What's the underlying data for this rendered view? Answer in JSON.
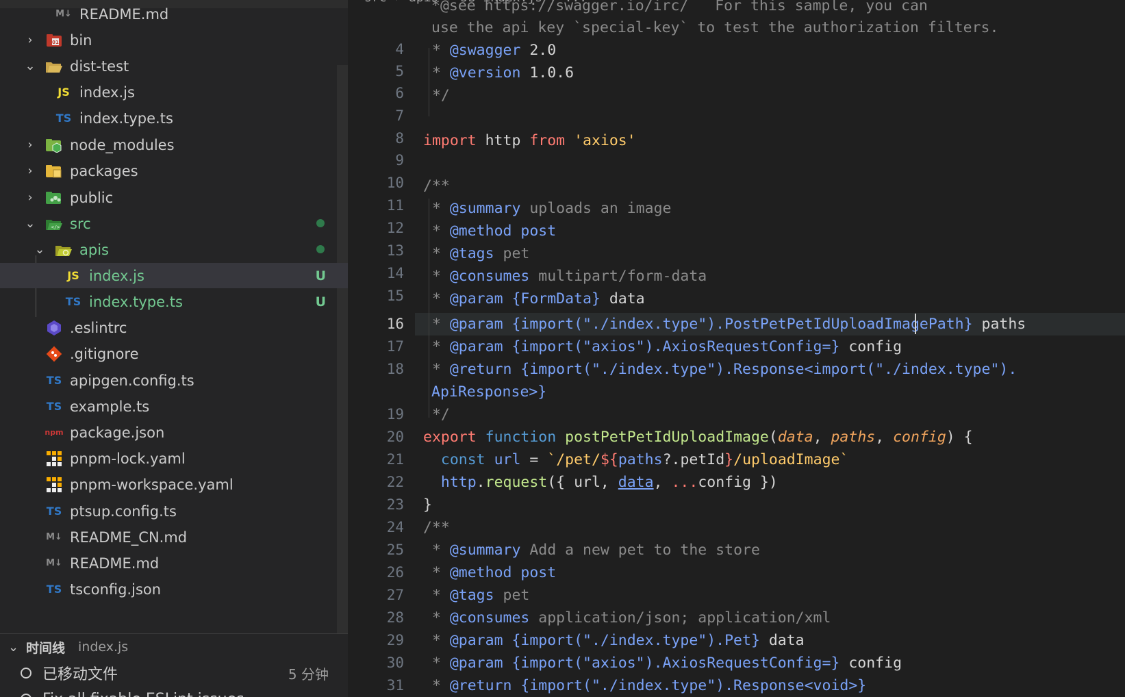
{
  "explorer": {
    "rows": [
      {
        "label": "README.md",
        "icon": "markdown-icon",
        "icon_text": "M↓",
        "kind": "file"
      },
      {
        "label": "bin",
        "icon": "folder-bin-icon",
        "kind": "folder",
        "expanded": false
      },
      {
        "label": "dist-test",
        "icon": "folder-open-icon",
        "kind": "folder",
        "expanded": true
      },
      {
        "label": "index.js",
        "icon": "js-file-icon",
        "icon_text": "JS",
        "kind": "file"
      },
      {
        "label": "index.type.ts",
        "icon": "ts-file-icon",
        "icon_text": "TS",
        "kind": "file"
      },
      {
        "label": "node_modules",
        "icon": "folder-node-icon",
        "kind": "folder",
        "expanded": false
      },
      {
        "label": "packages",
        "icon": "folder-packages-icon",
        "kind": "folder",
        "expanded": false
      },
      {
        "label": "public",
        "icon": "folder-public-icon",
        "kind": "folder",
        "expanded": false
      },
      {
        "label": "src",
        "icon": "folder-src-icon",
        "kind": "folder",
        "expanded": true
      },
      {
        "label": "apis",
        "icon": "folder-apis-icon",
        "kind": "folder",
        "expanded": true
      },
      {
        "label": "index.js",
        "icon": "js-file-icon",
        "icon_text": "JS",
        "kind": "file",
        "status": "U"
      },
      {
        "label": "index.type.ts",
        "icon": "ts-file-icon",
        "icon_text": "TS",
        "kind": "file",
        "status": "U"
      },
      {
        "label": ".eslintrc",
        "icon": "eslint-icon",
        "kind": "file"
      },
      {
        "label": ".gitignore",
        "icon": "git-icon",
        "kind": "file"
      },
      {
        "label": "apipgen.config.ts",
        "icon": "ts-file-icon",
        "icon_text": "TS",
        "kind": "file"
      },
      {
        "label": "example.ts",
        "icon": "ts-file-icon",
        "icon_text": "TS",
        "kind": "file"
      },
      {
        "label": "package.json",
        "icon": "npm-icon",
        "icon_text": "npm",
        "kind": "file"
      },
      {
        "label": "pnpm-lock.yaml",
        "icon": "pnpm-icon",
        "kind": "file"
      },
      {
        "label": "pnpm-workspace.yaml",
        "icon": "pnpm-icon",
        "kind": "file"
      },
      {
        "label": "ptsup.config.ts",
        "icon": "ts-file-icon",
        "icon_text": "TS",
        "kind": "file"
      },
      {
        "label": "README_CN.md",
        "icon": "markdown-icon",
        "icon_text": "M↓",
        "kind": "file"
      },
      {
        "label": "README.md",
        "icon": "markdown-icon",
        "icon_text": "M↓",
        "kind": "file"
      },
      {
        "label": "tsconfig.json",
        "icon": "tsconfig-icon",
        "icon_text": "TS",
        "kind": "file"
      }
    ]
  },
  "timeline": {
    "title": "时间线",
    "file": "index.js",
    "entries": [
      {
        "label": "已移动文件",
        "time": "5 分钟"
      },
      {
        "label": "Fix all fixable ESLint issues",
        "time": ""
      }
    ]
  },
  "editor": {
    "breadcrumb": "src › apis › JS index.js › ...",
    "current_line": "16",
    "line_numbers": [
      "",
      "",
      "4",
      "5",
      "6",
      "7",
      "8",
      "9",
      "10",
      "11",
      "12",
      "13",
      "14",
      "15",
      "16",
      "17",
      "18",
      "",
      "19",
      "20",
      "21",
      "22",
      "23",
      "24",
      "25",
      "26",
      "27",
      "28",
      "29",
      "30",
      "31"
    ]
  },
  "colors": {
    "sidebar_bg": "#252526",
    "editor_bg": "#1f1f1f",
    "untracked": "#73c991",
    "js_icon": "#f1dd35",
    "ts_icon": "#3178c6"
  }
}
